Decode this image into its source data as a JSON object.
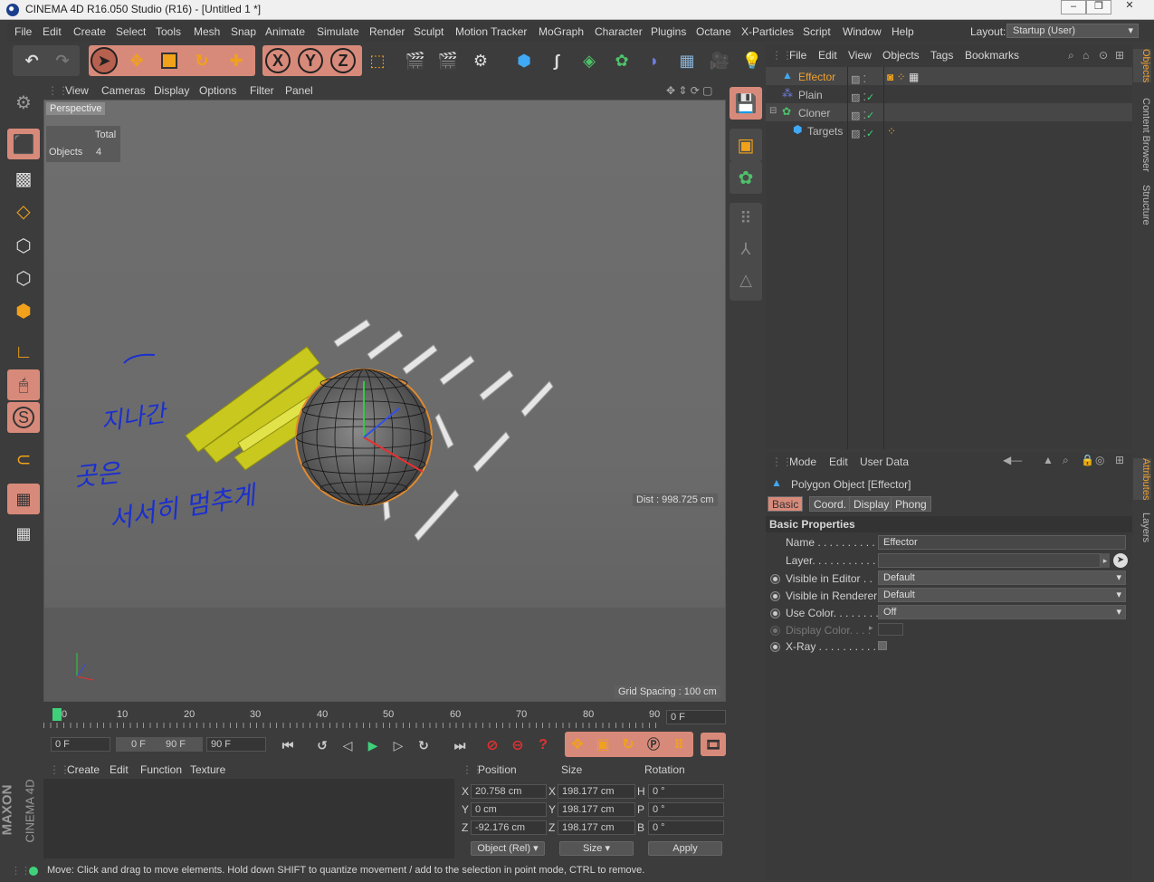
{
  "window": {
    "title": "CINEMA 4D R16.050 Studio (R16) - [Untitled 1 *]"
  },
  "menu": [
    "File",
    "Edit",
    "Create",
    "Select",
    "Tools",
    "Mesh",
    "Snap",
    "Animate",
    "Simulate",
    "Render",
    "Sculpt",
    "Motion Tracker",
    "MoGraph",
    "Character",
    "Plugins",
    "Octane",
    "X-Particles",
    "Script",
    "Window",
    "Help"
  ],
  "layout": {
    "label": "Layout:",
    "value": "Startup (User)"
  },
  "toolbar": {
    "icons": [
      "undo-icon",
      "redo-icon",
      "select-icon",
      "move-icon",
      "scale-icon",
      "rotate-icon",
      "add-icon",
      "x-axis-icon",
      "y-axis-icon",
      "z-axis-icon",
      "coordinate-system-icon",
      "render-view-icon",
      "render-picture-viewer-icon",
      "render-settings-icon",
      "cube-icon",
      "spline-icon",
      "nurbs-icon",
      "array-icon",
      "deformer-icon",
      "floor-icon",
      "camera-icon",
      "light-icon"
    ],
    "axes": [
      "X",
      "Y",
      "Z"
    ]
  },
  "viewport": {
    "menu": [
      "View",
      "Cameras",
      "Display",
      "Options",
      "Filter",
      "Panel"
    ],
    "camera_label": "Perspective",
    "hud_total": "Total",
    "hud_objects_label": "Objects",
    "hud_objects_value": "4",
    "distance": "Dist : 998.725 cm",
    "grid_spacing": "Grid Spacing : 100 cm",
    "annotation_lines": [
      "지나간",
      "곳은",
      "서서히 멈추게"
    ]
  },
  "timeline": {
    "ticks": [
      "0",
      "10",
      "20",
      "30",
      "40",
      "50",
      "60",
      "70",
      "80",
      "90"
    ],
    "current_frame": "0 F",
    "start_field": "0 F",
    "range_start": "0 F",
    "range_end": "90 F",
    "end_field": "90 F"
  },
  "material_menu": [
    "Create",
    "Edit",
    "Function",
    "Texture"
  ],
  "coords": {
    "headers": [
      "Position",
      "Size",
      "Rotation"
    ],
    "rows": [
      {
        "axis": "X",
        "pos": "20.758 cm",
        "size_axis": "X",
        "size": "198.177 cm",
        "rot_axis": "H",
        "rot": "0 °"
      },
      {
        "axis": "Y",
        "pos": "0 cm",
        "size_axis": "Y",
        "size": "198.177 cm",
        "rot_axis": "P",
        "rot": "0 °"
      },
      {
        "axis": "Z",
        "pos": "-92.176 cm",
        "size_axis": "Z",
        "size": "198.177 cm",
        "rot_axis": "B",
        "rot": "0 °"
      }
    ],
    "mode": "Object (Rel)",
    "size_mode": "Size",
    "apply": "Apply"
  },
  "status": "Move: Click and drag to move elements. Hold down SHIFT to quantize movement / add to the selection in point mode, CTRL to remove.",
  "objects_menu": [
    "File",
    "Edit",
    "View",
    "Objects",
    "Tags",
    "Bookmarks"
  ],
  "objects": [
    {
      "name": "Effector",
      "selected": true
    },
    {
      "name": "Plain",
      "selected": false
    },
    {
      "name": "Cloner",
      "selected": false
    },
    {
      "name": "Targets",
      "selected": false
    }
  ],
  "side_tabs_top": [
    "Objects",
    "Content Browser",
    "Structure"
  ],
  "side_tabs_bottom": [
    "Attributes",
    "Layers"
  ],
  "attributes": {
    "menu": [
      "Mode",
      "Edit",
      "User Data"
    ],
    "header": "Polygon Object [Effector]",
    "tabs": [
      "Basic",
      "Coord.",
      "Display",
      "Phong"
    ],
    "section": "Basic Properties",
    "name_label": "Name . . . . . . . . . . .",
    "name_value": "Effector",
    "layer_label": "Layer. . . . . . . . . . . .",
    "vis_editor_label": "Visible in Editor . .",
    "vis_editor_value": "Default",
    "vis_render_label": "Visible in Renderer",
    "vis_render_value": "Default",
    "use_color_label": "Use Color. . . . . . . .",
    "use_color_value": "Off",
    "display_color_label": "Display Color. . . .",
    "xray_label": "X-Ray . . . . . . . . . . ."
  },
  "brand": {
    "maxon": "MAXON",
    "product": "CINEMA 4D"
  },
  "colors": {
    "accent": "#d88a7a",
    "selected_text": "#f0a030",
    "annotation": "#1a2fd0"
  }
}
